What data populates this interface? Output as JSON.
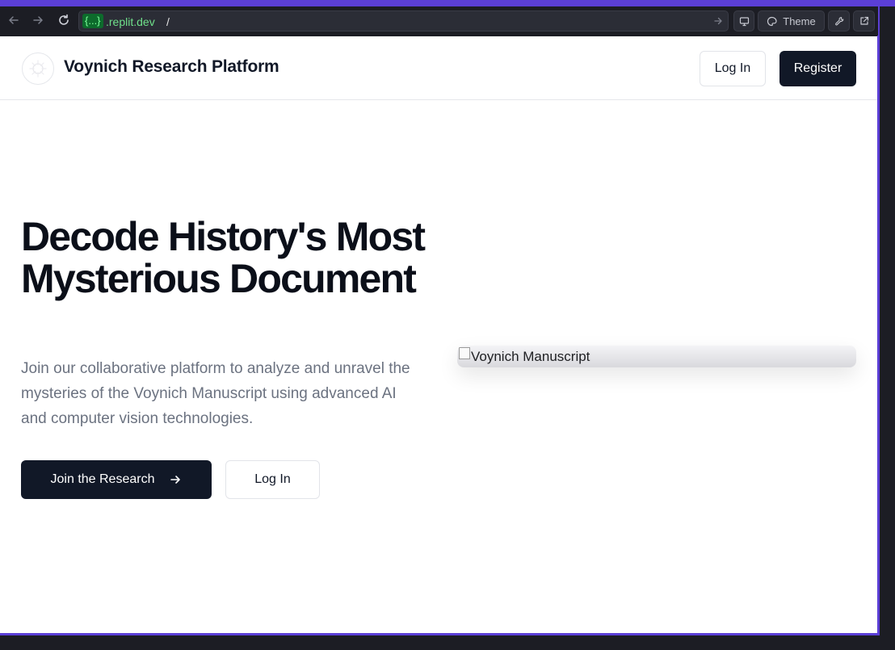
{
  "browser": {
    "url_chip": "{...}",
    "url_domain": ".replit.dev",
    "url_path": "/",
    "theme_label": "Theme",
    "icons": [
      "back-arrow-icon",
      "forward-arrow-icon",
      "reload-icon",
      "go-arrow-icon",
      "monitor-icon",
      "palette-icon",
      "wrench-icon",
      "external-link-icon"
    ]
  },
  "header": {
    "brand": "Voynich Research Platform",
    "login_label": "Log In",
    "register_label": "Register"
  },
  "hero": {
    "title": "Decode History's Most Mysterious Document",
    "subtitle": "Join our collaborative platform to analyze and unravel the mysteries of the Voynich Manuscript using advanced AI and computer vision technologies.",
    "primary_cta": "Join the Research",
    "secondary_cta": "Log In",
    "image_alt": "Voynich Manuscript"
  },
  "colors": {
    "accent": "#5b3fd6",
    "primary": "#111827",
    "muted_text": "#6b7280"
  }
}
